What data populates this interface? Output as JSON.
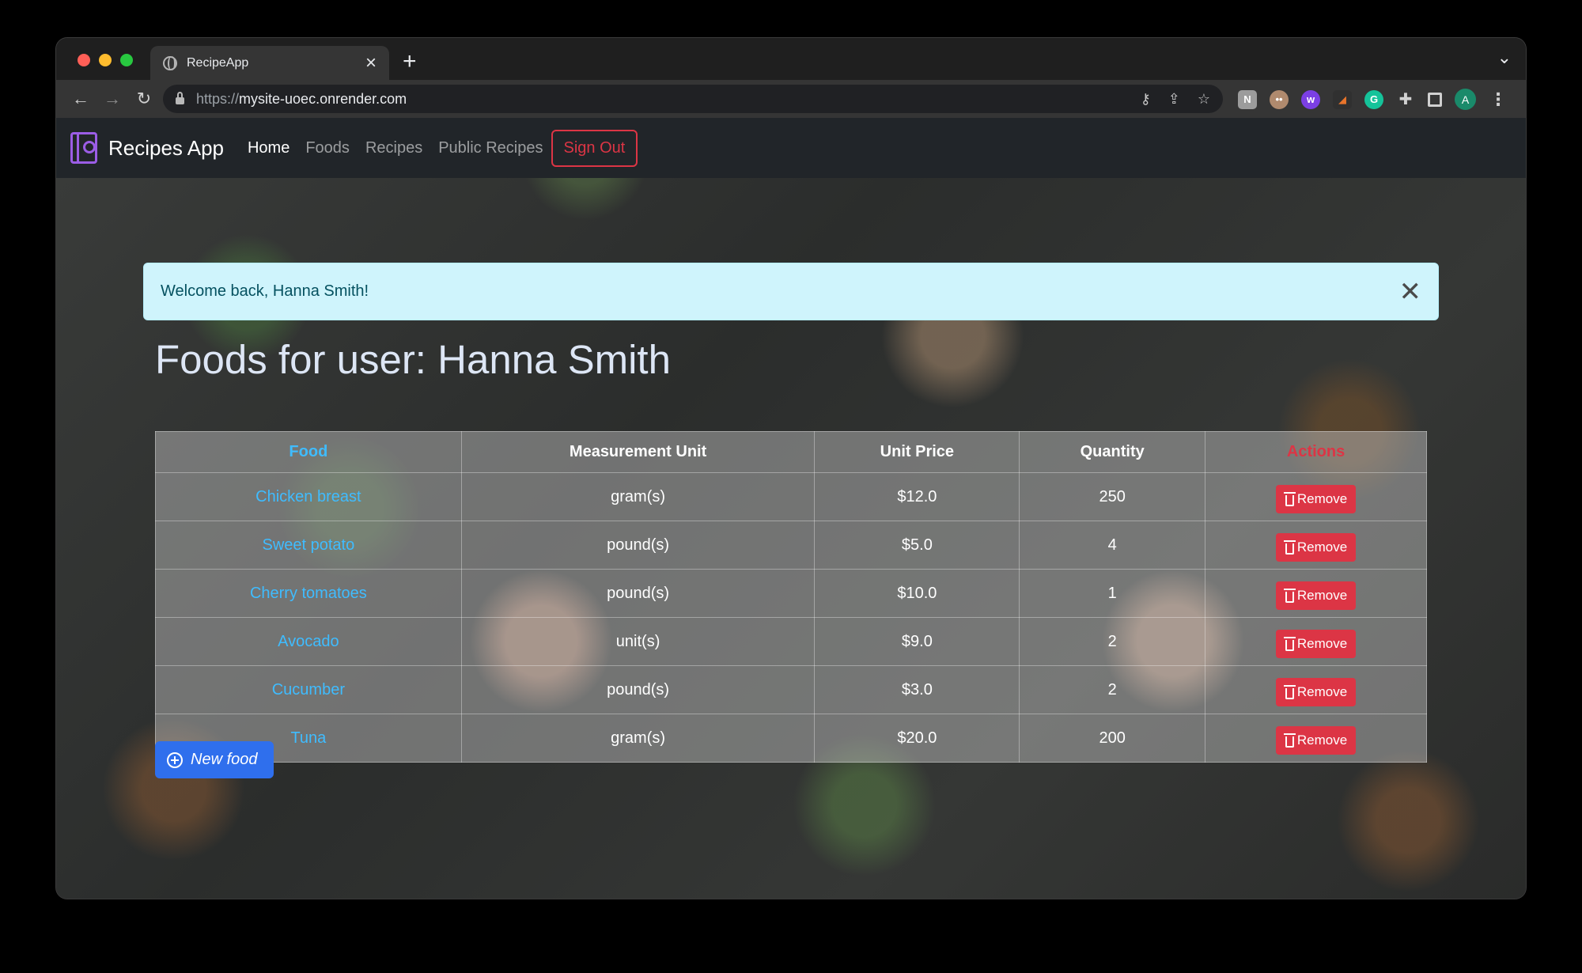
{
  "browser": {
    "tab_title": "RecipeApp",
    "url_scheme": "https://",
    "url_host": "mysite-uoec.onrender.com",
    "profile_initial": "A"
  },
  "navbar": {
    "brand": "Recipes App",
    "links": [
      "Home",
      "Foods",
      "Recipes",
      "Public Recipes"
    ],
    "active_link": "Home",
    "sign_out": "Sign Out"
  },
  "alert": {
    "message": "Welcome back, Hanna Smith!"
  },
  "heading": "Foods for user: Hanna Smith",
  "table": {
    "headers": [
      "Food",
      "Measurement Unit",
      "Unit Price",
      "Quantity",
      "Actions"
    ],
    "rows": [
      {
        "food": "Chicken breast",
        "unit": "gram(s)",
        "price": "$12.0",
        "quantity": "250",
        "action": "Remove"
      },
      {
        "food": "Sweet potato",
        "unit": "pound(s)",
        "price": "$5.0",
        "quantity": "4",
        "action": "Remove"
      },
      {
        "food": "Cherry tomatoes",
        "unit": "pound(s)",
        "price": "$10.0",
        "quantity": "1",
        "action": "Remove"
      },
      {
        "food": "Avocado",
        "unit": "unit(s)",
        "price": "$9.0",
        "quantity": "2",
        "action": "Remove"
      },
      {
        "food": "Cucumber",
        "unit": "pound(s)",
        "price": "$3.0",
        "quantity": "2",
        "action": "Remove"
      },
      {
        "food": "Tuna",
        "unit": "gram(s)",
        "price": "$20.0",
        "quantity": "200",
        "action": "Remove"
      }
    ]
  },
  "new_food_button": "New food",
  "colors": {
    "danger": "#dc3545",
    "primary": "#2f6fed",
    "link": "#3fbcff",
    "alert_bg": "#cff4fc",
    "navbar_bg": "#212529"
  }
}
